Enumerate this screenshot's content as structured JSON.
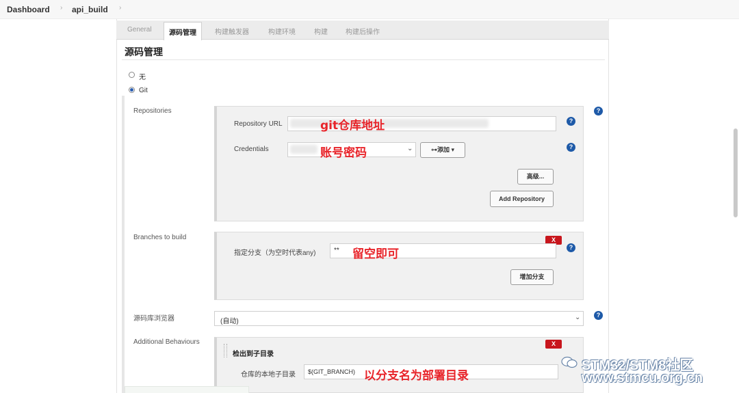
{
  "breadcrumb": {
    "items": [
      "Dashboard",
      "api_build"
    ]
  },
  "tabs": [
    "General",
    "源码管理",
    "构建触发器",
    "构建环境",
    "构建",
    "构建后操作"
  ],
  "active_tab": "源码管理",
  "section_title": "源码管理",
  "scm_options": {
    "none": "无",
    "git": "Git"
  },
  "repositories": {
    "label": "Repositories",
    "url_label": "Repository URL",
    "url_annotation": "git仓库地址",
    "credentials_label": "Credentials",
    "credentials_annotation": "账号密码",
    "add_button": "⊶添加",
    "advanced_button": "高级...",
    "add_repo_button": "Add Repository"
  },
  "branches": {
    "label": "Branches to build",
    "field_label": "指定分支（为空时代表any)",
    "value": "**",
    "annotation": "留空即可",
    "delete": "X",
    "add_branch_button": "增加分支"
  },
  "browser": {
    "label": "源码库浏览器",
    "value": "(自动)"
  },
  "behaviours": {
    "label": "Additional Behaviours",
    "item_title": "检出到子目录",
    "delete": "X",
    "subdir_label": "仓库的本地子目录",
    "subdir_value": "$(GIT_BRANCH)",
    "annotation": "以分支名为部署目录"
  },
  "help_glyph": "?",
  "watermark": {
    "line1": "STM32/STM8社区",
    "line2": "www.stmcu.org.cn"
  },
  "colors": {
    "annotation": "#e8242a",
    "help": "#1e5aa8",
    "delete": "#c8161d"
  }
}
